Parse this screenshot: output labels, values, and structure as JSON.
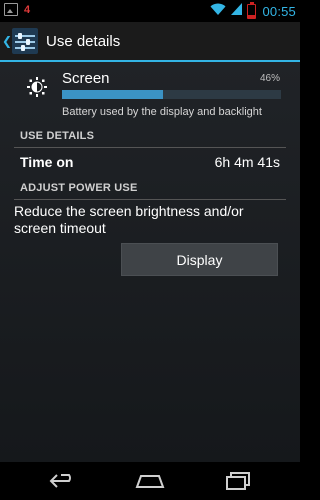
{
  "status_bar": {
    "notification_count": "4",
    "time": "00:55"
  },
  "action_bar": {
    "title": "Use details"
  },
  "screen_item": {
    "title": "Screen",
    "percent_label": "46%",
    "percent_value": 46,
    "description": "Battery used by the display and backlight"
  },
  "use_details": {
    "header": "USE DETAILS",
    "time_on_label": "Time on",
    "time_on_value": "6h 4m 41s"
  },
  "adjust_power": {
    "header": "ADJUST POWER USE",
    "message": "Reduce the screen brightness and/or screen timeout",
    "button_label": "Display"
  },
  "colors": {
    "accent": "#33b5e5",
    "bar_fill": "#3b93c5",
    "battery_low": "#cc2222"
  },
  "icons": {
    "status_left": [
      "image-notification-icon"
    ],
    "status_right": [
      "wifi-icon",
      "signal-icon",
      "battery-icon"
    ],
    "action_bar": [
      "back-caret-icon",
      "settings-sliders-icon"
    ],
    "screen_item": "brightness-icon",
    "nav": [
      "back-icon",
      "home-icon",
      "recent-apps-icon"
    ]
  }
}
